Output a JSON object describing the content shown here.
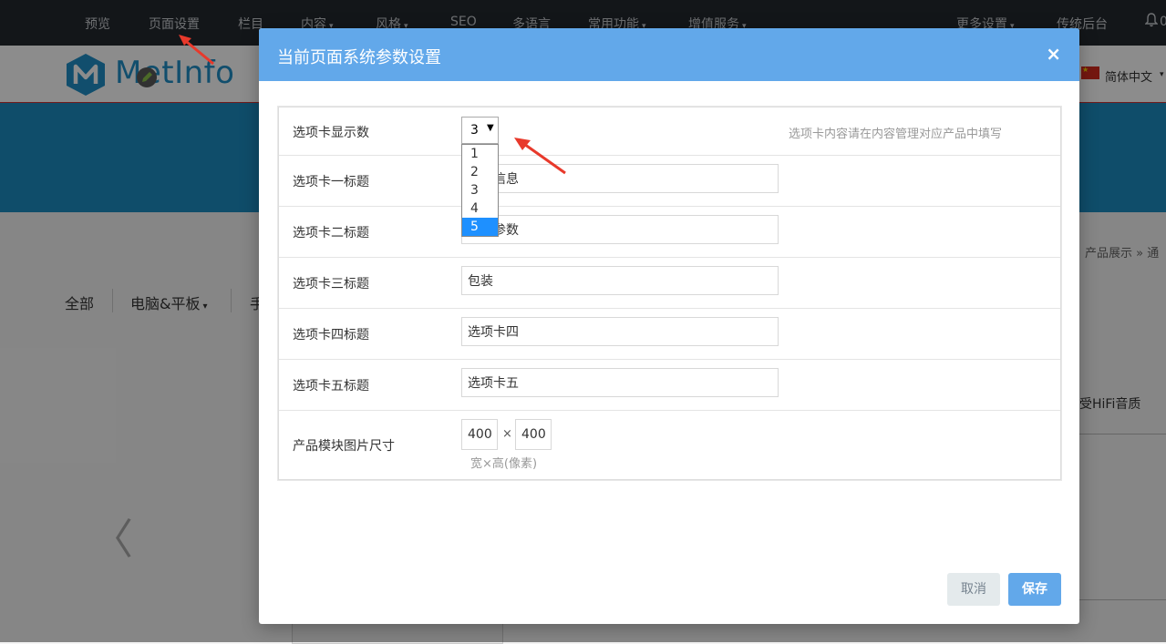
{
  "topnav": {
    "items": [
      {
        "label": "预览",
        "caret": ""
      },
      {
        "label": "页面设置",
        "caret": ""
      },
      {
        "label": "栏目",
        "caret": ""
      },
      {
        "label": "内容",
        "caret": "▾"
      },
      {
        "label": "风格",
        "caret": "▾"
      },
      {
        "label": "SEO",
        "caret": ""
      },
      {
        "label": "多语言",
        "caret": ""
      },
      {
        "label": "常用功能",
        "caret": "▾"
      },
      {
        "label": "增值服务",
        "caret": "▾"
      },
      {
        "label": "更多设置",
        "caret": "▾"
      },
      {
        "label": "传统后台",
        "caret": ""
      }
    ],
    "bell_suffix": "0"
  },
  "header": {
    "logo_text": "MetInfo",
    "language": "简体中文",
    "language_caret": "▾"
  },
  "page": {
    "breadcrumb": "产品展示 »  通",
    "filters": [
      "全部",
      "电脑&平板",
      "手"
    ],
    "filter_caret": "▾",
    "side_text": "受HiFi音质",
    "prev_arrow": "〈"
  },
  "modal": {
    "title": "当前页面系统参数设置",
    "close": "×",
    "tab_count": {
      "label": "选项卡显示数",
      "value": "3",
      "arrow": "▼",
      "options": [
        "1",
        "2",
        "3",
        "4",
        "5"
      ],
      "highlighted": "5",
      "hint": "选项卡内容请在内容管理对应产品中填写"
    },
    "rows": [
      {
        "label": "选项卡一标题",
        "value": "详细信息"
      },
      {
        "label": "选项卡二标题",
        "value": "规格参数"
      },
      {
        "label": "选项卡三标题",
        "value": "包装"
      },
      {
        "label": "选项卡四标题",
        "value": "选项卡四"
      },
      {
        "label": "选项卡五标题",
        "value": "选项卡五"
      }
    ],
    "image_size": {
      "label": "产品模块图片尺寸",
      "width": "400",
      "height": "400",
      "separator": "×",
      "hint": "宽×高(像素)"
    },
    "cancel_label": "取消",
    "save_label": "保存"
  },
  "colors": {
    "modal_header": "#62a8ea",
    "nav_bg": "#23282f",
    "banner": "#1c8cc1",
    "dropdown_highlight": "#1e90ff",
    "annotation_arrow": "#e8392b"
  }
}
